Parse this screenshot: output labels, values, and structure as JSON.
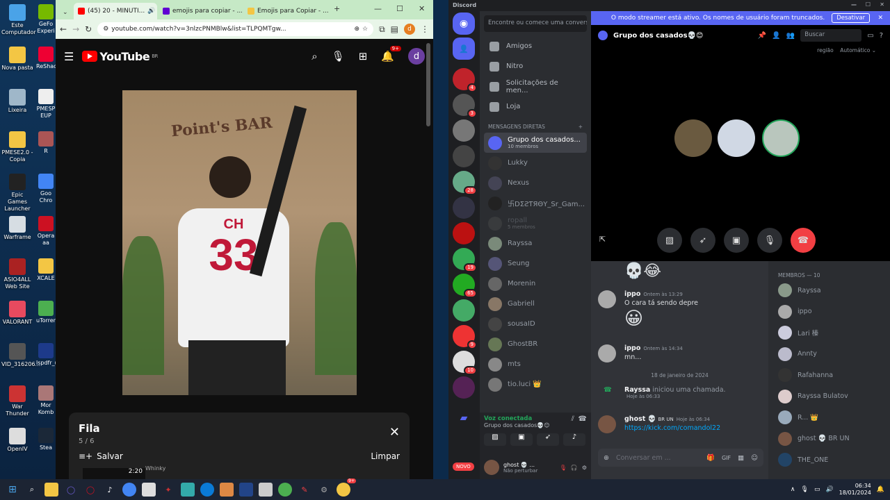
{
  "desktop": {
    "icons": [
      {
        "label": "Este Computador",
        "color": "#4aa3e8"
      },
      {
        "label": "Nova pasta",
        "color": "#f3c644"
      },
      {
        "label": "Lixeira",
        "color": "#9fb7c9"
      },
      {
        "label": "PMESE2.0 - Copia",
        "color": "#f3c644"
      },
      {
        "label": "Epic Games Launcher",
        "color": "#222"
      },
      {
        "label": "Warframe",
        "color": "#d6dde3"
      },
      {
        "label": "ASIO4ALL Web Site",
        "color": "#a22"
      },
      {
        "label": "VALORANT",
        "color": "#e84a5f"
      },
      {
        "label": "VID_316206...",
        "color": "#555"
      },
      {
        "label": "War Thunder",
        "color": "#c33"
      },
      {
        "label": "OpenIV",
        "color": "#ddd"
      }
    ],
    "icons2": [
      {
        "label": "GeFo Experi",
        "color": "#76b900"
      },
      {
        "label": "ReShac",
        "color": "#e03"
      },
      {
        "label": "PMESP EUP",
        "color": "#eee"
      },
      {
        "label": "R",
        "color": "#a55"
      },
      {
        "label": "Goo Chro",
        "color": "#4285f4"
      },
      {
        "label": "Opera aa",
        "color": "#c12"
      },
      {
        "label": "XCALE",
        "color": "#f3c644"
      },
      {
        "label": "uTorren",
        "color": "#4caf50"
      },
      {
        "label": "lspdfr_(",
        "color": "#1d3a8a"
      },
      {
        "label": "Mor Komb",
        "color": "#a77"
      },
      {
        "label": "Stea",
        "color": "#1b2838"
      }
    ]
  },
  "chrome": {
    "tabs": [
      {
        "title": "(45) 20 - MINUTI...",
        "active": true,
        "favicon_color": "#f00"
      },
      {
        "title": "emojis para copiar - ...",
        "active": false,
        "favicon_color": "#6001d2"
      },
      {
        "title": "Emojis para Copiar - ...",
        "active": false,
        "favicon_color": "#f3c644"
      }
    ],
    "new_tab": "+",
    "url": "youtube.com/watch?v=3nlzcPNMBlw&list=TLPQMTgw...",
    "profile_letter": "d"
  },
  "youtube": {
    "logo_text": "YouTube",
    "region": "BR",
    "notif_count": "9+",
    "avatar_letter": "d",
    "video_text": {
      "shirt_letters": "CH",
      "shirt_number": "33",
      "sign": "Point's BAR"
    },
    "queue": {
      "title": "Fila",
      "position": "5 / 6",
      "save": "Salvar",
      "clear": "Limpar",
      "item_duration": "2:20",
      "item_channel": "Whinky"
    }
  },
  "discord": {
    "title": "Discord",
    "streamer_banner": "O modo streamer está ativo. Os nomes de usuário foram truncados.",
    "streamer_button": "Desativar",
    "search_placeholder": "Encontre ou comece uma conversa",
    "nav": [
      {
        "label": "Amigos"
      },
      {
        "label": "Nitro"
      },
      {
        "label": "Solicitações de men..."
      },
      {
        "label": "Loja"
      }
    ],
    "dm_header": "MENSAGENS DIRETAS",
    "dms": [
      {
        "name": "Grupo dos casados...",
        "sub": "10 membros",
        "active": true,
        "color": "#5865f2"
      },
      {
        "name": "Lukky",
        "sub": "",
        "active": false,
        "color": "#333"
      },
      {
        "name": "Nexus",
        "sub": "",
        "active": false,
        "color": "#445"
      },
      {
        "name": "卐DΣƧƬЯΘY_Sr_Gam...",
        "sub": "",
        "active": false,
        "color": "#222"
      },
      {
        "name": "ropall",
        "sub": "5 membros",
        "active": false,
        "color": "#555"
      },
      {
        "name": "Rayssa",
        "sub": "",
        "active": false,
        "color": "#7a8a7a"
      },
      {
        "name": "Seung",
        "sub": "",
        "active": false,
        "color": "#557"
      },
      {
        "name": "Morenin",
        "sub": "",
        "active": false,
        "color": "#666"
      },
      {
        "name": "Gabriell",
        "sub": "",
        "active": false,
        "color": "#876"
      },
      {
        "name": "sousaID",
        "sub": "",
        "active": false,
        "color": "#444"
      },
      {
        "name": "GhostBR",
        "sub": "",
        "active": false,
        "color": "#675"
      },
      {
        "name": "mts",
        "sub": "",
        "active": false,
        "color": "#888"
      },
      {
        "name": "tio.luci 👑",
        "sub": "",
        "active": false,
        "color": "#777"
      }
    ],
    "voice": {
      "status": "Voz conectada",
      "channel": "Grupo dos casados💀😊"
    },
    "user": {
      "name": "ghost 💀 ...",
      "status": "Não perturbar"
    },
    "new_badge": "NOVO",
    "guild_badges": [
      "4",
      "3",
      "",
      "",
      "28",
      "",
      "",
      "19",
      "65",
      "",
      "9",
      "10",
      ""
    ],
    "channel_title": "Grupo dos casados💀😊",
    "search": "Buscar",
    "region_label": "região",
    "region_value": "Automático",
    "messages": [
      {
        "name": "ippo",
        "time": "Ontem às 13:29",
        "text": "O cara tá sendo depre",
        "emoji": "😀"
      },
      {
        "name": "ippo",
        "time": "Ontem às 14:34",
        "text": "mn...",
        "emoji": ""
      }
    ],
    "top_emojis": "💀😂",
    "date_divider": "18 de janeiro de 2024",
    "call_event": {
      "name": "Rayssa",
      "text": "iniciou uma chamada.",
      "time": "Hoje às 06:33"
    },
    "last_message": {
      "name": "ghost 💀",
      "tag": "BR UN",
      "time": "Hoje às 06:34",
      "text": "https://kick.com/comandol22"
    },
    "input_placeholder": "Conversar em ...",
    "members_header": "MEMBROS — 10",
    "members": [
      {
        "name": "Rayssa",
        "color": "#8a9a8a"
      },
      {
        "name": "ippo",
        "color": "#aaa"
      },
      {
        "name": "Lari 榛",
        "color": "#ccd"
      },
      {
        "name": "Annty",
        "color": "#bbc"
      },
      {
        "name": "Rafahanna",
        "color": "#333"
      },
      {
        "name": "Rayssa Bulatov",
        "color": "#dcc"
      },
      {
        "name": "R... 👑",
        "color": "#9ab"
      },
      {
        "name": "ghost 💀 BR UN",
        "color": "#754"
      },
      {
        "name": "THE_ONE",
        "color": "#246"
      }
    ]
  },
  "taskbar": {
    "time": "06:34",
    "date": "18/01/2024",
    "notif": "9+"
  }
}
